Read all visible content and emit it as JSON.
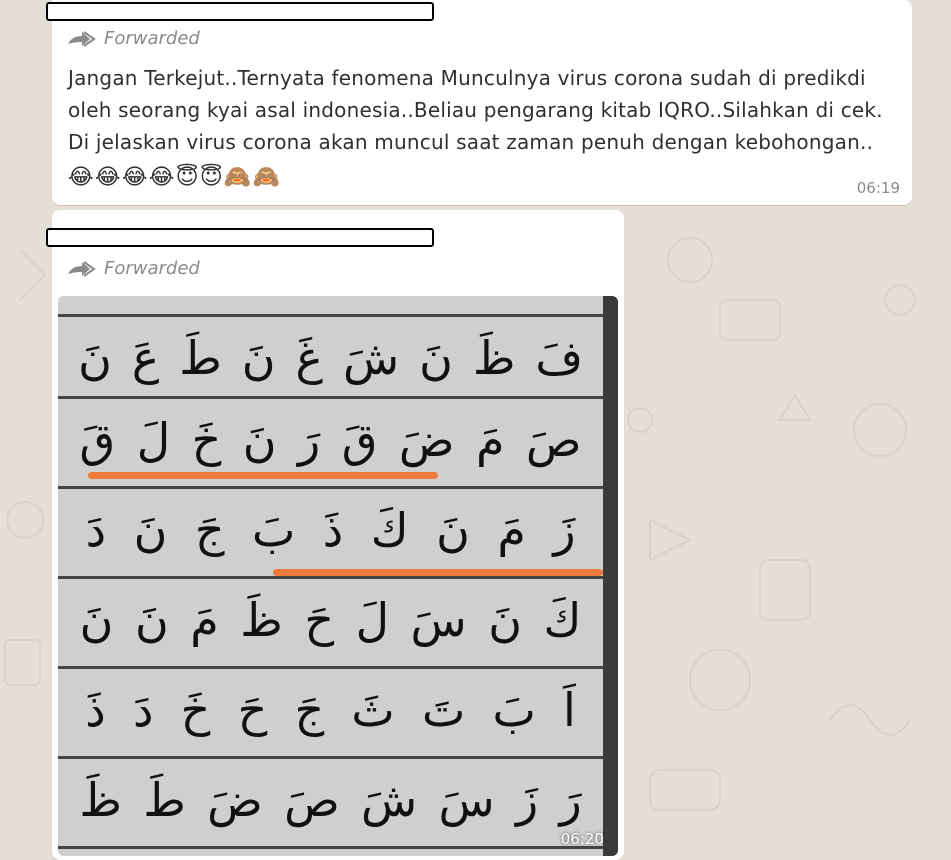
{
  "messages": [
    {
      "forwarded_label": "Forwarded",
      "text": "Jangan Terkejut..Ternyata fenomena Munculnya virus corona sudah di predikdi oleh seorang kyai asal indonesia..Beliau pengarang kitab IQRO..Silahkan di cek. Di jelaskan virus corona akan muncul saat zaman penuh dengan kebohongan..",
      "emojis": [
        "😂",
        "😂",
        "😂",
        "😂",
        "😇",
        "😇",
        "🙈",
        "🙈"
      ],
      "time": "06:19"
    },
    {
      "forwarded_label": "Forwarded",
      "time": "06:20",
      "photo": {
        "rows": [
          [
            "فَ",
            "ظَ",
            "نَ",
            "شَ",
            "غَ",
            "نَ",
            "طَ",
            "عَ",
            "نَ"
          ],
          [
            "صَ",
            "مَ",
            "ضَ",
            "قَ",
            "رَ",
            "نَ",
            "خَ",
            "لَ",
            "قَ"
          ],
          [
            "زَ",
            "مَ",
            "نَ",
            "كَ",
            "ذَ",
            "بَ",
            "جَ",
            "نَ",
            "دَ"
          ],
          [
            "كَ",
            "نَ",
            "سَ",
            "لَ",
            "حَ",
            "ظَ",
            "مَ",
            "نَ",
            "نَ"
          ],
          [
            "اَ",
            "بَ",
            "تَ",
            "ثَ",
            "جَ",
            "حَ",
            "خَ",
            "دَ",
            "ذَ"
          ],
          [
            "رَ",
            "زَ",
            "سَ",
            "شَ",
            "صَ",
            "ضَ",
            "طَ",
            "ظَ"
          ]
        ],
        "highlight_color": "#f07a3a"
      }
    }
  ]
}
